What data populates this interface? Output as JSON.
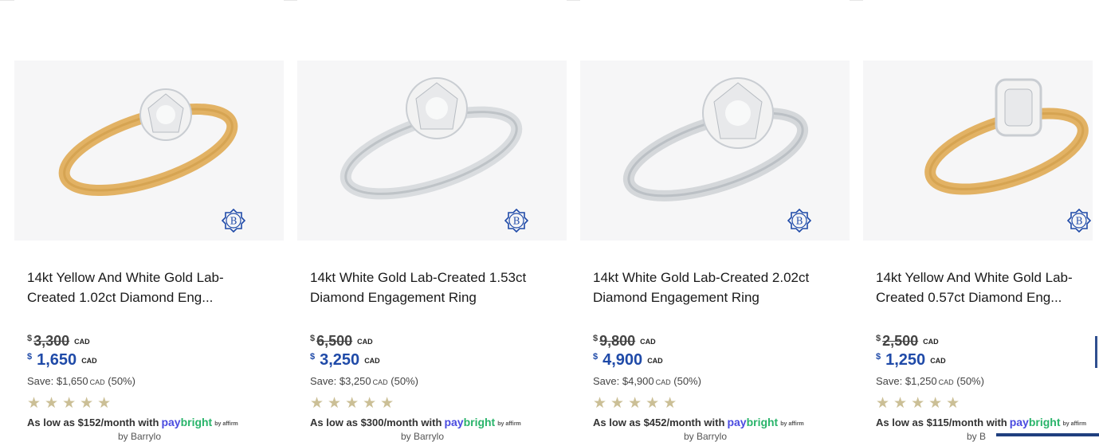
{
  "products": [
    {
      "title": "14kt Yellow And White Gold Lab-Created 1.02ct Diamond Eng...",
      "was_currency": "$",
      "was_amount": "3,300",
      "now_currency": "$",
      "now_amount": "1,650",
      "currency_code": "CAD",
      "save_text": "Save: $1,650",
      "save_pct": "(50%)",
      "rating_stars": 5,
      "stars": "★★★★★",
      "finance_text": "As low as $152/month with",
      "paybright_a": "pay",
      "paybright_b": "bright",
      "affirm_text": "by affirm",
      "cut_text": "by Barrylo",
      "band_color": "#e2b264",
      "brand_icon": "birks-b-icon"
    },
    {
      "title": "14kt White Gold Lab-Created 1.53ct Diamond Engagement Ring",
      "was_currency": "$",
      "was_amount": "6,500",
      "now_currency": "$",
      "now_amount": "3,250",
      "currency_code": "CAD",
      "save_text": "Save: $3,250",
      "save_pct": "(50%)",
      "rating_stars": 5,
      "stars": "★★★★★",
      "finance_text": "As low as $300/month with",
      "paybright_a": "pay",
      "paybright_b": "bright",
      "affirm_text": "by affirm",
      "cut_text": "by Barrylo",
      "band_color": "#d9dcdf",
      "brand_icon": "birks-b-icon"
    },
    {
      "title": "14kt White Gold Lab-Created 2.02ct Diamond Engagement Ring",
      "was_currency": "$",
      "was_amount": "9,800",
      "now_currency": "$",
      "now_amount": "4,900",
      "currency_code": "CAD",
      "save_text": "Save: $4,900",
      "save_pct": "(50%)",
      "rating_stars": 5,
      "stars": "★★★★★",
      "finance_text": "As low as $452/month with",
      "paybright_a": "pay",
      "paybright_b": "bright",
      "affirm_text": "by affirm",
      "cut_text": "by Barrylo",
      "band_color": "#d4d7da",
      "brand_icon": "birks-b-icon"
    },
    {
      "title": "14kt Yellow And White Gold Lab-Created 0.57ct Diamond Eng...",
      "was_currency": "$",
      "was_amount": "2,500",
      "now_currency": "$",
      "now_amount": "1,250",
      "currency_code": "CAD",
      "save_text": "Save: $1,250",
      "save_pct": "(50%)",
      "rating_stars": 5,
      "stars": "★★★★★",
      "finance_text": "As low as $115/month with",
      "paybright_a": "pay",
      "paybright_b": "bright",
      "affirm_text": "by affirm",
      "cut_text": "by B",
      "band_color": "#e2b264",
      "brand_icon": "birks-b-icon"
    }
  ],
  "colors": {
    "price_blue": "#1f4aa8",
    "star_gold": "#cbbf96",
    "paybright_purple": "#4a4be0",
    "paybright_green": "#29b46a",
    "badge_navy": "#1f3f7f"
  }
}
